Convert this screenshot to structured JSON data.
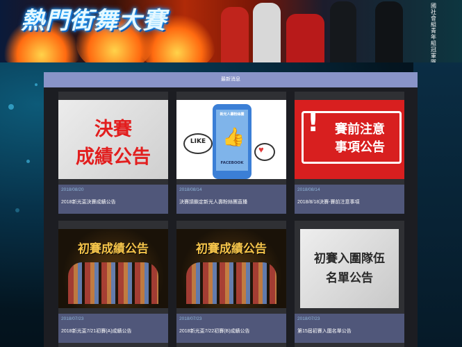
{
  "banner": {
    "title": "熱門街舞大賽",
    "side_text": "國社會組青年組冠軍隊伍"
  },
  "section": {
    "header": "最新消息"
  },
  "cards": [
    {
      "image_text": [
        "決賽",
        "成績公告"
      ],
      "date": "2018/08/20",
      "title": "2018新光盃決賽成績公告"
    },
    {
      "image_text": [
        "新光人壽粉絲團",
        "LIKE",
        "FACEBOOK"
      ],
      "date": "2018/08/14",
      "title": "決賽請鎖定新光人壽粉絲團直播"
    },
    {
      "image_text": [
        "賽前注意",
        "事項公告"
      ],
      "date": "2018/08/14",
      "title": "2018/8/18決賽-賽前注意事項"
    },
    {
      "image_text": [
        "初賽成績公告"
      ],
      "date": "2018/07/23",
      "title": "2018新光盃7/21初賽(A)成績公告"
    },
    {
      "image_text": [
        "初賽成績公告"
      ],
      "date": "2018/07/23",
      "title": "2018新光盃7/22初賽(B)成績公告"
    },
    {
      "image_text": [
        "初賽入圍隊伍",
        "名單公告"
      ],
      "date": "2018/07/23",
      "title": "第15屆初賽入圍名單公告"
    }
  ],
  "colors": {
    "header": "#8994c8",
    "meta": "#50577a",
    "red": "#d81f1f"
  },
  "icons": [
    "thumbs-up-icon",
    "heart-icon",
    "exclamation-icon"
  ]
}
